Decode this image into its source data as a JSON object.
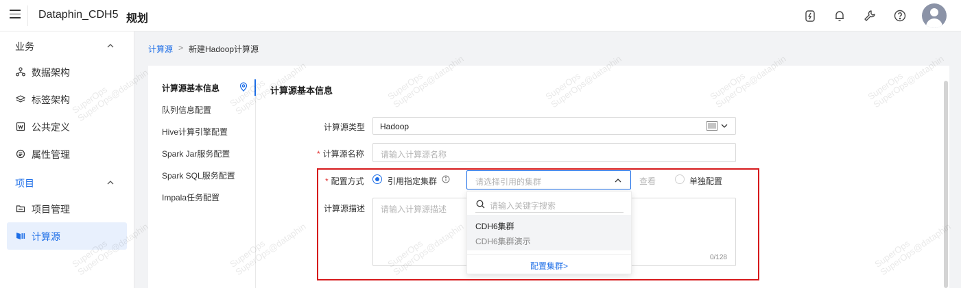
{
  "header": {
    "title": "Dataphin_CDH5",
    "section": "规划",
    "icons": [
      "bolt-icon",
      "bell-icon",
      "wrench-icon",
      "help-icon"
    ]
  },
  "sidebar": {
    "groups": [
      {
        "label": "业务",
        "items": [
          {
            "label": "数据架构",
            "icon": "hierarchy-icon"
          },
          {
            "label": "标签架构",
            "icon": "layers-icon"
          },
          {
            "label": "公共定义",
            "icon": "w-doc-icon"
          },
          {
            "label": "属性管理",
            "icon": "attribute-icon"
          }
        ]
      },
      {
        "label": "项目",
        "items": [
          {
            "label": "项目管理",
            "icon": "folder-icon"
          },
          {
            "label": "计算源",
            "icon": "compute-source-icon",
            "selected": true
          }
        ]
      }
    ]
  },
  "breadcrumb": {
    "root": "计算源",
    "separator": ">",
    "current": "新建Hadoop计算源"
  },
  "anchor_nav": [
    "计算源基本信息",
    "队列信息配置",
    "Hive计算引擎配置",
    "Spark Jar服务配置",
    "Spark SQL服务配置",
    "Impala任务配置"
  ],
  "form": {
    "section_title": "计算源基本信息",
    "type_label": "计算源类型",
    "type_value": "Hadoop",
    "name_label": "计算源名称",
    "name_placeholder": "请输入计算源名称",
    "config_label": "配置方式",
    "radio_cluster": "引用指定集群",
    "cluster_placeholder": "请选择引用的集群",
    "view_link": "查看",
    "radio_single": "单独配置",
    "desc_label": "计算源描述",
    "desc_placeholder": "请输入计算源描述",
    "desc_counter": "0/128"
  },
  "dropdown": {
    "search_placeholder": "请输入关键字搜索",
    "options": [
      {
        "name": "CDH6集群",
        "desc": "CDH6集群演示"
      }
    ],
    "footer_link": "配置集群>"
  },
  "watermark": {
    "line1": "SuperOps",
    "line2": "SuperOps@dataphin"
  },
  "colors": {
    "accent": "#1d6ee7",
    "required": "#e03131",
    "highlight": "#d6191b"
  }
}
